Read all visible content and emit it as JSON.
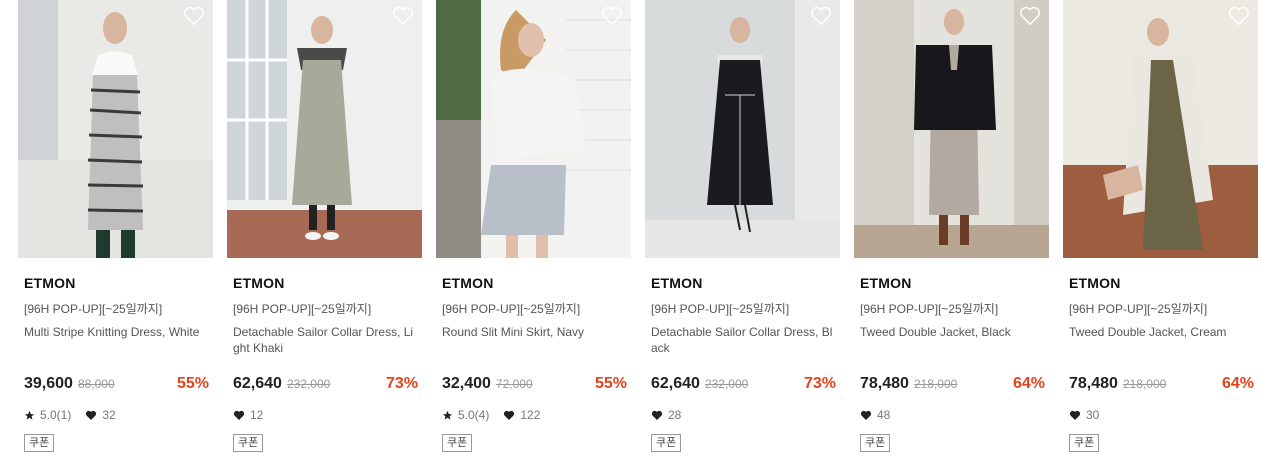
{
  "products": [
    {
      "brand": "ETMON",
      "promo": "[96H POP-UP][~25일까지]",
      "name": "Multi Stripe Knitting Dress, White",
      "price": "39,600",
      "original_price": "88,000",
      "discount": "55%",
      "rating": "5.0(1)",
      "likes": "32",
      "coupon": "쿠폰",
      "wishlist_icon": "heart-outline-icon"
    },
    {
      "brand": "ETMON",
      "promo": "[96H POP-UP][~25일까지]",
      "name": "Detachable Sailor Collar Dress, Light Khaki",
      "price": "62,640",
      "original_price": "232,000",
      "discount": "73%",
      "rating": null,
      "likes": "12",
      "coupon": "쿠폰",
      "wishlist_icon": "heart-outline-icon"
    },
    {
      "brand": "ETMON",
      "promo": "[96H POP-UP][~25일까지]",
      "name": "Round Slit Mini Skirt, Navy",
      "price": "32,400",
      "original_price": "72,000",
      "discount": "55%",
      "rating": "5.0(4)",
      "likes": "122",
      "coupon": "쿠폰",
      "wishlist_icon": "heart-outline-icon"
    },
    {
      "brand": "ETMON",
      "promo": "[96H POP-UP][~25일까지]",
      "name": "Detachable Sailor Collar Dress, Black",
      "price": "62,640",
      "original_price": "232,000",
      "discount": "73%",
      "rating": null,
      "likes": "28",
      "coupon": "쿠폰",
      "wishlist_icon": "heart-outline-icon"
    },
    {
      "brand": "ETMON",
      "promo": "[96H POP-UP][~25일까지]",
      "name": "Tweed Double Jacket, Black",
      "price": "78,480",
      "original_price": "218,000",
      "discount": "64%",
      "rating": null,
      "likes": "48",
      "coupon": "쿠폰",
      "wishlist_icon": "heart-outline-icon"
    },
    {
      "brand": "ETMON",
      "promo": "[96H POP-UP][~25일까지]",
      "name": "Tweed Double Jacket, Cream",
      "price": "78,480",
      "original_price": "218,000",
      "discount": "64%",
      "rating": null,
      "likes": "30",
      "coupon": "쿠폰",
      "wishlist_icon": "heart-outline-icon"
    }
  ],
  "colors": {
    "discount": "#e6431c",
    "price": "#222222",
    "muted": "#999999"
  }
}
